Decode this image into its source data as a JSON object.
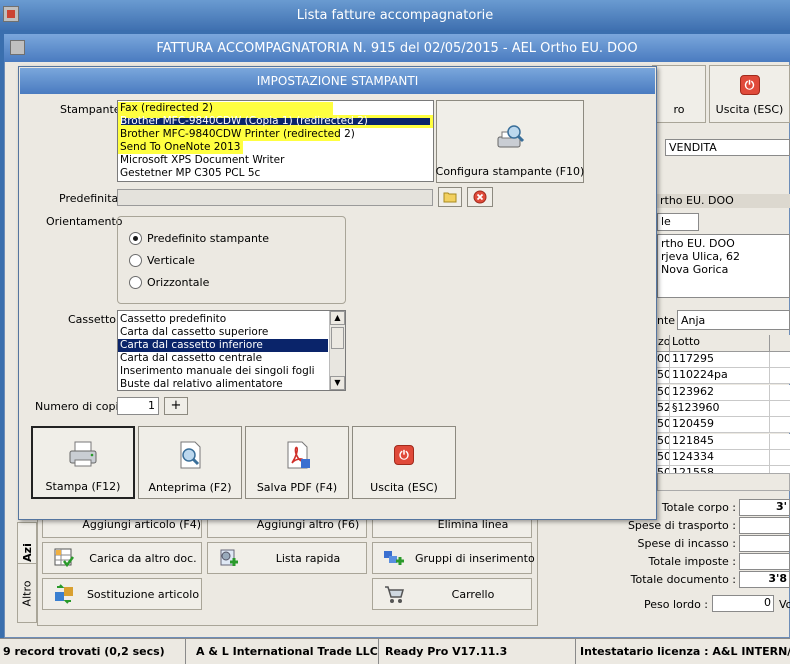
{
  "app": {
    "title": "Lista fatture accompagnatorie"
  },
  "invoice": {
    "title": "FATTURA ACCOMPAGNATORIA N. 915 del 02/05/2015 - AEL Ortho EU. DOO",
    "toolbar": {
      "partial_label": "ro",
      "exit_label": "Uscita (ESC)"
    },
    "fields": {
      "type_value": "VENDITA",
      "customer_header": "rtho EU. DOO",
      "small_field": "le",
      "address_lines": [
        "rtho EU. DOO",
        "rjeva Ulica, 62",
        "Nova Gorica"
      ],
      "agent_label": "nte",
      "agent_value": "Anja"
    },
    "grid": {
      "col1_header": "zo",
      "col2_header": "Lotto",
      "rows": [
        {
          "a": "00",
          "b": "117295"
        },
        {
          "a": "50",
          "b": "110224pa"
        },
        {
          "a": "50",
          "b": "123962"
        },
        {
          "a": "52",
          "b": "§123960"
        },
        {
          "a": "50",
          "b": "120459"
        },
        {
          "a": "50",
          "b": "121845"
        },
        {
          "a": "50",
          "b": "124334"
        },
        {
          "a": "50",
          "b": "121558"
        }
      ]
    },
    "totals": {
      "corpo_label": "Totale corpo :",
      "corpo_value": "3'",
      "trasporto_label": "Spese di trasporto :",
      "incasso_label": "Spese di incasso :",
      "imposte_label": "Totale imposte :",
      "documento_label": "Totale documento :",
      "documento_value": "3'8",
      "peso_label": "Peso lordo :",
      "peso_value": "0",
      "peso_suffix": "Vo"
    },
    "side_tabs": {
      "top": "Azi",
      "bottom": "Altro"
    },
    "buttons": {
      "aggiungi_articolo": "Aggiungi articolo (F4)",
      "aggiungi_altro": "Aggiungi altro (F6)",
      "elimina_linea": "Elimina linea",
      "carica": "Carica da altro doc.",
      "lista_rapida": "Lista rapida",
      "gruppi": "Gruppi di inserimento",
      "sostituzione": "Sostituzione articolo",
      "carrello": "Carrello"
    }
  },
  "dialog": {
    "title": "IMPOSTAZIONE STAMPANTI",
    "printer_label": "Stampante",
    "printers": [
      {
        "name": "Fax (redirected 2)",
        "selected": false
      },
      {
        "name": "Brother MFC-9840CDW (Copia 1) (redirected 2)",
        "selected": true
      },
      {
        "name": "Brother MFC-9840CDW Printer (redirected 2)",
        "selected": false
      },
      {
        "name": "Send To OneNote 2013",
        "selected": false
      },
      {
        "name": "Microsoft XPS Document Writer",
        "selected": false
      },
      {
        "name": "Gestetner MP C305 PCL 5c",
        "selected": false
      }
    ],
    "configure_button": "Configura stampante (F10)",
    "default_label": "Predefinita",
    "orientation_label": "Orientamento",
    "orientations": [
      {
        "label": "Predefinito stampante",
        "checked": true
      },
      {
        "label": "Verticale",
        "checked": false
      },
      {
        "label": "Orizzontale",
        "checked": false
      }
    ],
    "tray_label": "Cassetto",
    "trays": [
      {
        "name": "Cassetto predefinito",
        "selected": false
      },
      {
        "name": "Carta dal cassetto superiore",
        "selected": false
      },
      {
        "name": "Carta dal cassetto inferiore",
        "selected": true
      },
      {
        "name": "Carta dal cassetto centrale",
        "selected": false
      },
      {
        "name": "Inserimento manuale dei singoli fogli",
        "selected": false
      },
      {
        "name": "Buste dal relativo alimentatore",
        "selected": false
      }
    ],
    "copies_label": "Numero di copie",
    "copies_value": "1",
    "plus_label": "+",
    "actions": {
      "print": "Stampa (F12)",
      "preview": "Anteprima (F2)",
      "save_pdf": "Salva PDF (F4)",
      "exit": "Uscita (ESC)"
    }
  },
  "status_bar": {
    "records": "9 record trovati (0,2 secs)",
    "company": "A & L International Trade LLC",
    "version": "Ready Pro V17.11.3",
    "license": "Intestatario licenza : A&L INTERN/"
  },
  "colors": {
    "title_blue": "#4a7bc0",
    "selection": "#0a246a",
    "highlight": "#ffff40",
    "exit_red": "#e04a3a"
  }
}
